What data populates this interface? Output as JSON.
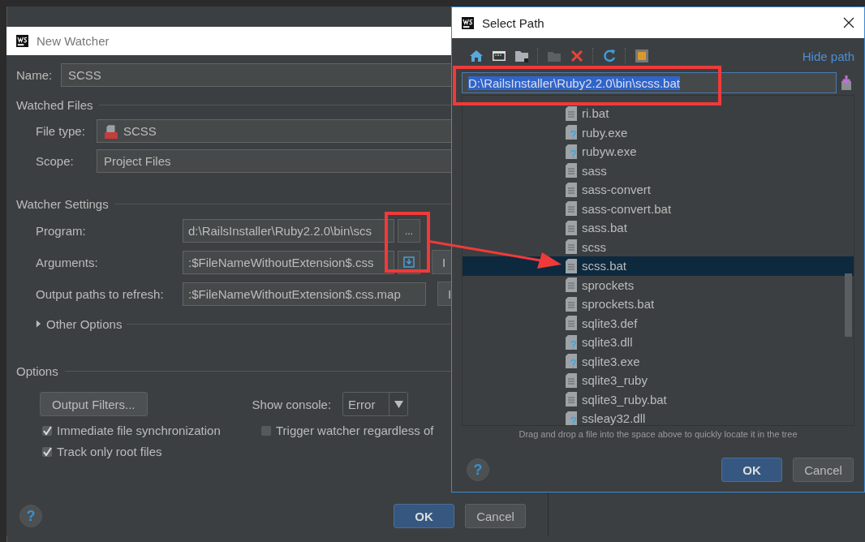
{
  "new_watcher": {
    "title": "New Watcher",
    "name": {
      "label": "Name:",
      "value": "SCSS"
    },
    "watched_files": {
      "heading": "Watched Files",
      "file_type": {
        "label": "File type:",
        "value": "SCSS"
      },
      "scope": {
        "label": "Scope:",
        "value": "Project Files"
      }
    },
    "watcher_settings": {
      "heading": "Watcher Settings",
      "program": {
        "label": "Program:",
        "value": "d:\\RailsInstaller\\Ruby2.2.0\\bin\\scs",
        "browse": "..."
      },
      "arguments": {
        "label": "Arguments:",
        "value": ":$FileNameWithoutExtension$.css",
        "insert": "I"
      },
      "output_paths": {
        "label": "Output paths to refresh:",
        "value": ":$FileNameWithoutExtension$.css.map",
        "insert": "I"
      },
      "other_options": {
        "label": "Other Options",
        "expanded": false
      }
    },
    "options": {
      "heading": "Options",
      "output_filters": "Output Filters...",
      "show_console": {
        "label": "Show console:",
        "value": "Error"
      },
      "checkboxes": [
        {
          "label": "Immediate file synchronization",
          "checked": true
        },
        {
          "label": "Trigger watcher regardless of",
          "checked": false
        },
        {
          "label": "Track only root files",
          "checked": true
        }
      ]
    },
    "help": "?",
    "buttons": [
      {
        "label": "OK",
        "default": true
      },
      {
        "label": "Cancel",
        "default": false
      }
    ]
  },
  "select_path": {
    "title": "Select Path",
    "hide_path": "Hide path",
    "path": {
      "value": "D:\\RailsInstaller\\Ruby2.2.0\\bin\\scss.bat",
      "text_selected": true
    },
    "files": [
      {
        "name": "ri.bat",
        "kind": "text",
        "selected": false
      },
      {
        "name": "ruby.exe",
        "kind": "unknown",
        "selected": false
      },
      {
        "name": "rubyw.exe",
        "kind": "unknown",
        "selected": false
      },
      {
        "name": "sass",
        "kind": "text",
        "selected": false
      },
      {
        "name": "sass-convert",
        "kind": "text",
        "selected": false
      },
      {
        "name": "sass-convert.bat",
        "kind": "text",
        "selected": false
      },
      {
        "name": "sass.bat",
        "kind": "text",
        "selected": false
      },
      {
        "name": "scss",
        "kind": "text",
        "selected": false
      },
      {
        "name": "scss.bat",
        "kind": "text",
        "selected": true
      },
      {
        "name": "sprockets",
        "kind": "text",
        "selected": false
      },
      {
        "name": "sprockets.bat",
        "kind": "text",
        "selected": false
      },
      {
        "name": "sqlite3.def",
        "kind": "text",
        "selected": false
      },
      {
        "name": "sqlite3.dll",
        "kind": "unknown",
        "selected": false
      },
      {
        "name": "sqlite3.exe",
        "kind": "unknown",
        "selected": false
      },
      {
        "name": "sqlite3_ruby",
        "kind": "text",
        "selected": false
      },
      {
        "name": "sqlite3_ruby.bat",
        "kind": "text",
        "selected": false
      },
      {
        "name": "ssleay32.dll",
        "kind": "unknown",
        "selected": false
      }
    ],
    "hint": "Drag and drop a file into the space above to quickly locate it in the tree",
    "help": "?",
    "buttons": [
      {
        "label": "OK",
        "default": true
      },
      {
        "label": "Cancel",
        "default": false
      }
    ]
  }
}
